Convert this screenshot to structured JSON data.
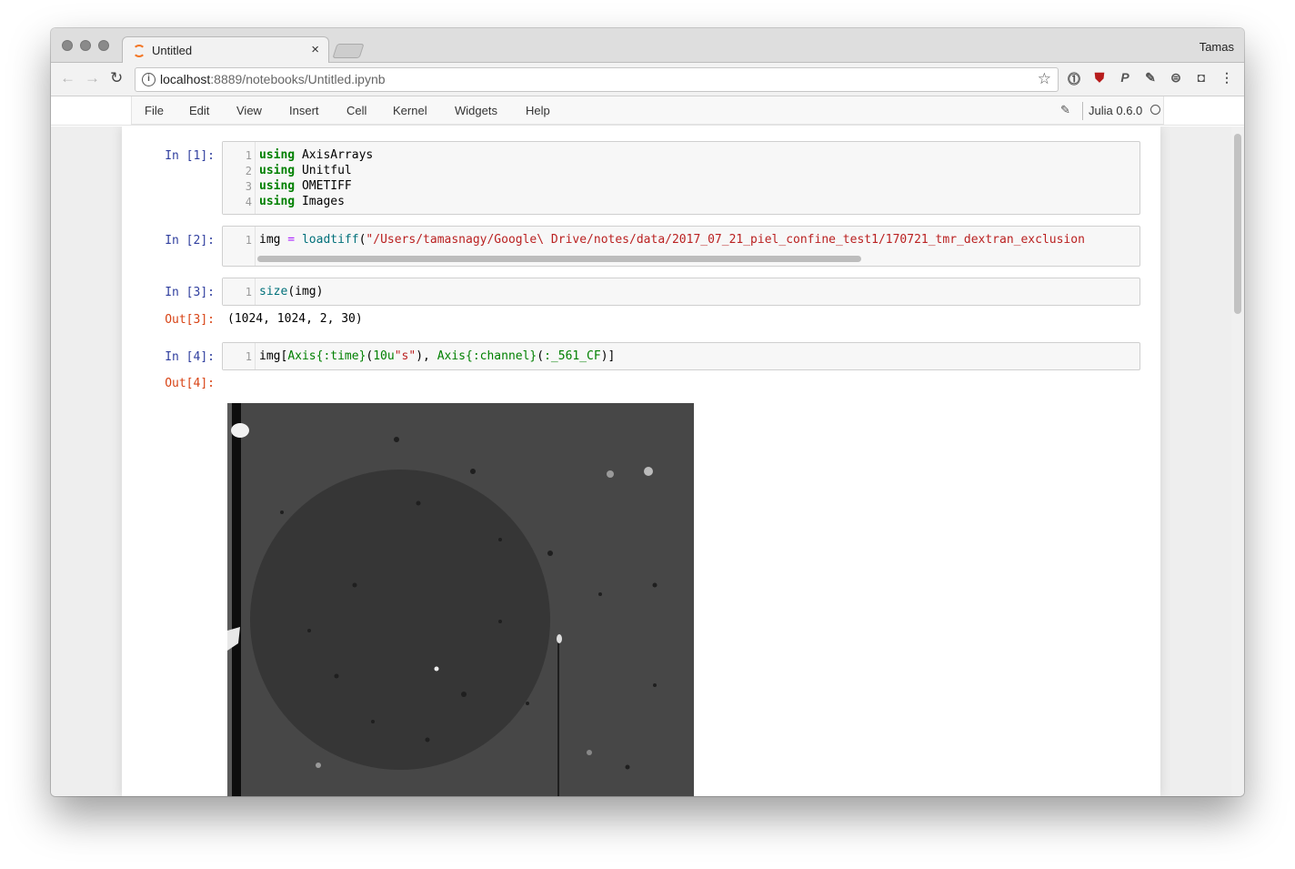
{
  "browser": {
    "tab_title": "Untitled",
    "tab_close": "×",
    "user": "Tamas",
    "url_host": "localhost",
    "url_rest": ":8889/notebooks/Untitled.ipynb"
  },
  "menubar": {
    "items": [
      "File",
      "Edit",
      "View",
      "Insert",
      "Cell",
      "Kernel",
      "Widgets",
      "Help"
    ],
    "kernel_name": "Julia 0.6.0"
  },
  "cells": [
    {
      "prompt": "In [1]:",
      "lines": [
        {
          "n": "1",
          "kw": "using",
          "rest": " AxisArrays"
        },
        {
          "n": "2",
          "kw": "using",
          "rest": " Unitful"
        },
        {
          "n": "3",
          "kw": "using",
          "rest": " OMETIFF"
        },
        {
          "n": "4",
          "kw": "using",
          "rest": " Images"
        }
      ]
    },
    {
      "prompt": "In [2]:",
      "line_number": "1",
      "var": "img",
      "op": " = ",
      "fn": "loadtiff",
      "open": "(",
      "str": "\"/Users/tamasnagy/Google\\ Drive/notes/data/2017_07_21_piel_confine_test1/170721_tmr_dextran_exclusion"
    },
    {
      "prompt": "In [3]:",
      "line_number": "1",
      "fn": "size",
      "args": "(img)",
      "out_prompt": "Out[3]:",
      "output": "(1024, 1024, 2, 30)"
    },
    {
      "prompt": "In [4]:",
      "line_number": "1",
      "p1": "img[",
      "t1": "Axis{:time}",
      "p2": "(",
      "n1": "10u",
      "s1": "\"s\"",
      "p3": "), ",
      "t2": "Axis{:channel}",
      "p4": "(",
      "t3": ":_561_CF",
      "p5": ")]",
      "out_prompt": "Out[4]:"
    }
  ]
}
